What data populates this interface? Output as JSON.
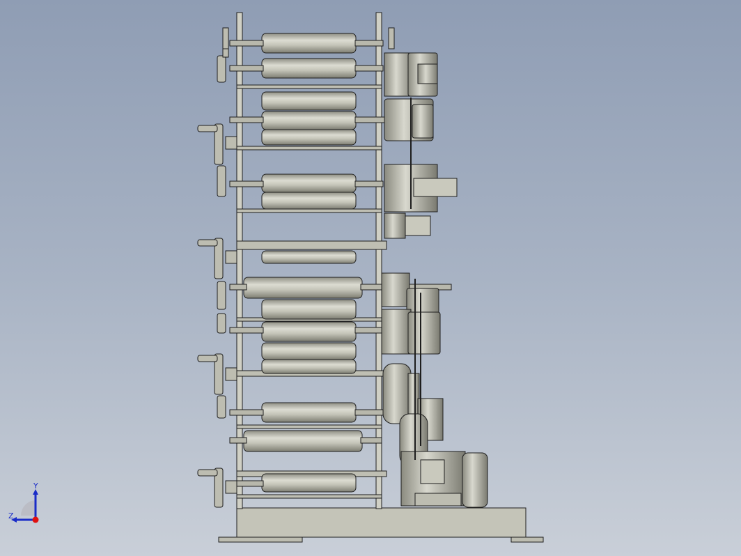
{
  "view": {
    "background_top": "#8f9db4",
    "background_bottom": "#c9cfd8",
    "model_fill": "#c9c9bd",
    "model_shade": "#a9a99c",
    "model_edge": "#1e1e1e"
  },
  "triad": {
    "y_label": "Y",
    "z_label": "Z",
    "y_color": "#1a2cc8",
    "z_color": "#1a2cc8",
    "x_color": "#e01010"
  }
}
